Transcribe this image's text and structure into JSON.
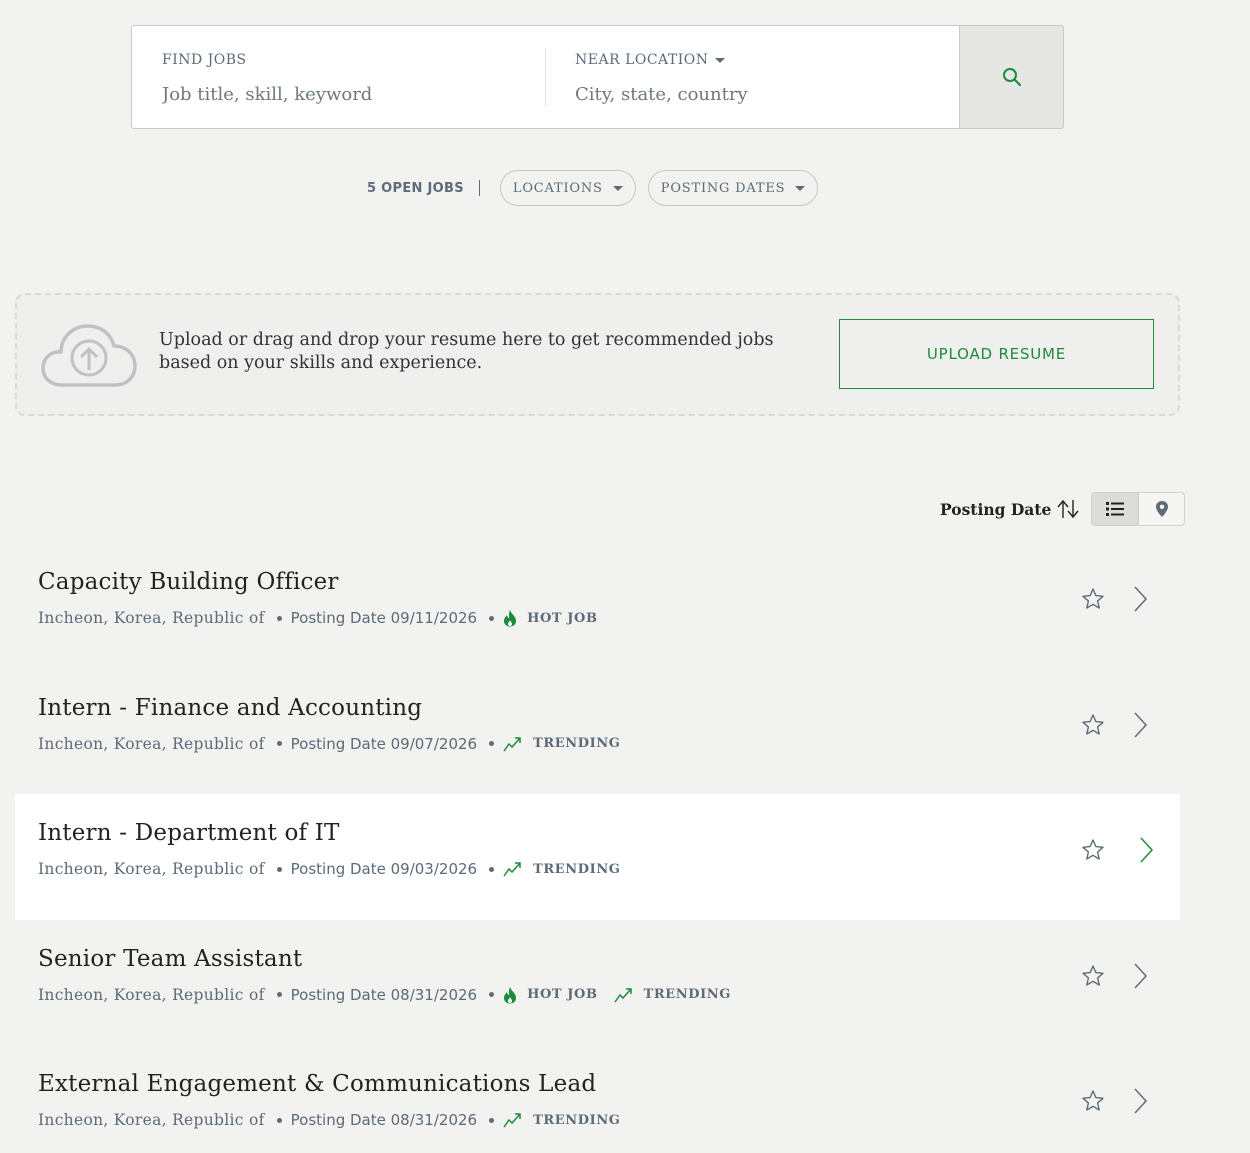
{
  "search": {
    "find_label": "FIND JOBS",
    "find_placeholder": "Job title, skill, keyword",
    "near_label": "NEAR LOCATION",
    "near_placeholder": "City, state, country",
    "button_icon": "search-icon"
  },
  "filters": {
    "open_jobs": "5 OPEN JOBS",
    "locations": "LOCATIONS",
    "posting_dates": "POSTING DATES"
  },
  "upload": {
    "text": "Upload or drag and drop your resume here to get recommended jobs based on your skills and experience.",
    "button": "UPLOAD RESUME",
    "icon": "cloud-upload-icon"
  },
  "sort": {
    "label": "Posting Date",
    "views": [
      "list-view",
      "map-view"
    ],
    "active_view": "list-view"
  },
  "colors": {
    "accent": "#1e8a3c",
    "muted": "#5c6b77",
    "background": "#f2f2f0"
  },
  "jobs": [
    {
      "title": "Capacity Building Officer",
      "location": "Incheon, Korea, Republic of",
      "date": "Posting Date 09/11/2026",
      "tags": [
        "HOT JOB"
      ]
    },
    {
      "title": "Intern - Finance and Accounting",
      "location": "Incheon, Korea, Republic of",
      "date": "Posting Date 09/07/2026",
      "tags": [
        "TRENDING"
      ]
    },
    {
      "title": "Intern - Department of IT",
      "location": "Incheon, Korea, Republic of",
      "date": "Posting Date 09/03/2026",
      "tags": [
        "TRENDING"
      ]
    },
    {
      "title": "Senior Team Assistant",
      "location": "Incheon, Korea, Republic of",
      "date": "Posting Date 08/31/2026",
      "tags": [
        "HOT JOB",
        "TRENDING"
      ]
    },
    {
      "title": "External Engagement & Communications Lead",
      "location": "Incheon, Korea, Republic of",
      "date": "Posting Date 08/31/2026",
      "tags": [
        "TRENDING"
      ]
    }
  ]
}
